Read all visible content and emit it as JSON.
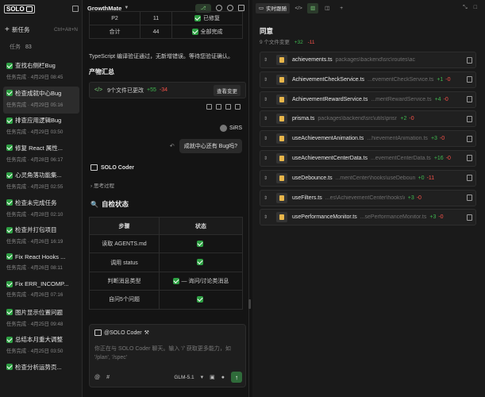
{
  "sidebar": {
    "logo": "SOLO",
    "new_task_label": "新任务",
    "new_task_shortcut": "Ctrl+Alt+N",
    "task_label": "任务",
    "task_count": "83",
    "tasks": [
      {
        "title": "查找右侧栏Bug",
        "sub": "任务完成 · 4月29日 08:45",
        "active": false
      },
      {
        "title": "检查成就中心Bug",
        "sub": "任务完成 · 4月29日 05:16",
        "active": true
      },
      {
        "title": "排查应用逻辑Bug",
        "sub": "任务完成 · 4月29日 03:50",
        "active": false
      },
      {
        "title": "修复 React 属性...",
        "sub": "任务完成 · 4月28日 06:17",
        "active": false
      },
      {
        "title": "心灵角落功能集...",
        "sub": "任务完成 · 4月28日 02:55",
        "active": false
      },
      {
        "title": "检查未完成任务",
        "sub": "任务完成 · 4月28日 02:10",
        "active": false
      },
      {
        "title": "检查并打包项目",
        "sub": "任务完成 · 4月26日 16:19",
        "active": false
      },
      {
        "title": "Fix React Hooks ...",
        "sub": "任务完成 · 4月26日 08:11",
        "active": false
      },
      {
        "title": "Fix ERR_INCOMP...",
        "sub": "任务完成 · 4月26日 07:16",
        "active": false
      },
      {
        "title": "图片显示位置问题",
        "sub": "任务完成 · 4月25日 09:48",
        "active": false
      },
      {
        "title": "总结本月重大调整",
        "sub": "任务完成 · 4月25日 03:50",
        "active": false
      },
      {
        "title": "检查分析运势页...",
        "sub": "",
        "active": false
      }
    ]
  },
  "chat": {
    "header_title": "GrowthMate",
    "table1": [
      {
        "a": "P2",
        "b": "11",
        "c": "已修复"
      },
      {
        "a": "合计",
        "b": "44",
        "c": "全部完成"
      }
    ],
    "paragraph": "TypeScript 编译验证通过，无新增错误。等待您验证确认。",
    "products_heading": "产物汇总",
    "changes_text": "9个文件已更改",
    "changes_plus": "+55",
    "changes_minus": "-34",
    "view_changes": "查看变更",
    "username": "SiRS",
    "user_message": "成就中心还有 Bug吗?",
    "solo_label": "SOLO Coder",
    "thinking": "思考过程",
    "self_check_title": "自检状态",
    "table2_headers": [
      "步骤",
      "状态"
    ],
    "table2_rows": [
      {
        "step": "读取 AGENTS.md",
        "status": ""
      },
      {
        "step": "调用 status",
        "status": ""
      },
      {
        "step": "判断消息类型",
        "status": "— 询问/讨论类消息"
      },
      {
        "step": "自问5个问题",
        "status": ""
      }
    ],
    "mention": "@SOLO Coder",
    "placeholder": "你正在与 SOLO Coder 聊天。输入 '/' 获取更多能力，如 '/plan', '/spec'",
    "model": "GLM-5.1"
  },
  "right": {
    "active_tab": "实时跟随",
    "title": "同意",
    "sub_count": "9 个文件变更",
    "sub_plus": "+32",
    "sub_minus": "-11",
    "files": [
      {
        "name": "achievements.ts",
        "path": "packages\\backend\\src\\routes\\achievements.ts",
        "plus": "",
        "minus": ""
      },
      {
        "name": "AchievementCheckService.ts",
        "path": "...evementCheckService.ts",
        "plus": "+1",
        "minus": "-0"
      },
      {
        "name": "AchievementRewardService.ts",
        "path": "...mentRewardService.ts",
        "plus": "+4",
        "minus": "-0"
      },
      {
        "name": "prisma.ts",
        "path": "packages\\backend\\src\\utils\\prisma.ts",
        "plus": "+2",
        "minus": "-0"
      },
      {
        "name": "useAchievementAnimation.ts",
        "path": "...hievementAnimation.ts",
        "plus": "+3",
        "minus": "-0"
      },
      {
        "name": "useAchievementCenterData.ts",
        "path": "...evementCenterData.ts",
        "plus": "+16",
        "minus": "-0"
      },
      {
        "name": "useDebounce.ts",
        "path": "...mentCenter\\hooks\\useDebounce.ts",
        "plus": "+0",
        "minus": "-11"
      },
      {
        "name": "useFilters.ts",
        "path": "...es\\AchievementCenter\\hooks\\useFilters.ts",
        "plus": "+3",
        "minus": "-0"
      },
      {
        "name": "usePerformanceMonitor.ts",
        "path": "...sePerformanceMonitor.ts",
        "plus": "+3",
        "minus": "-0"
      }
    ]
  }
}
